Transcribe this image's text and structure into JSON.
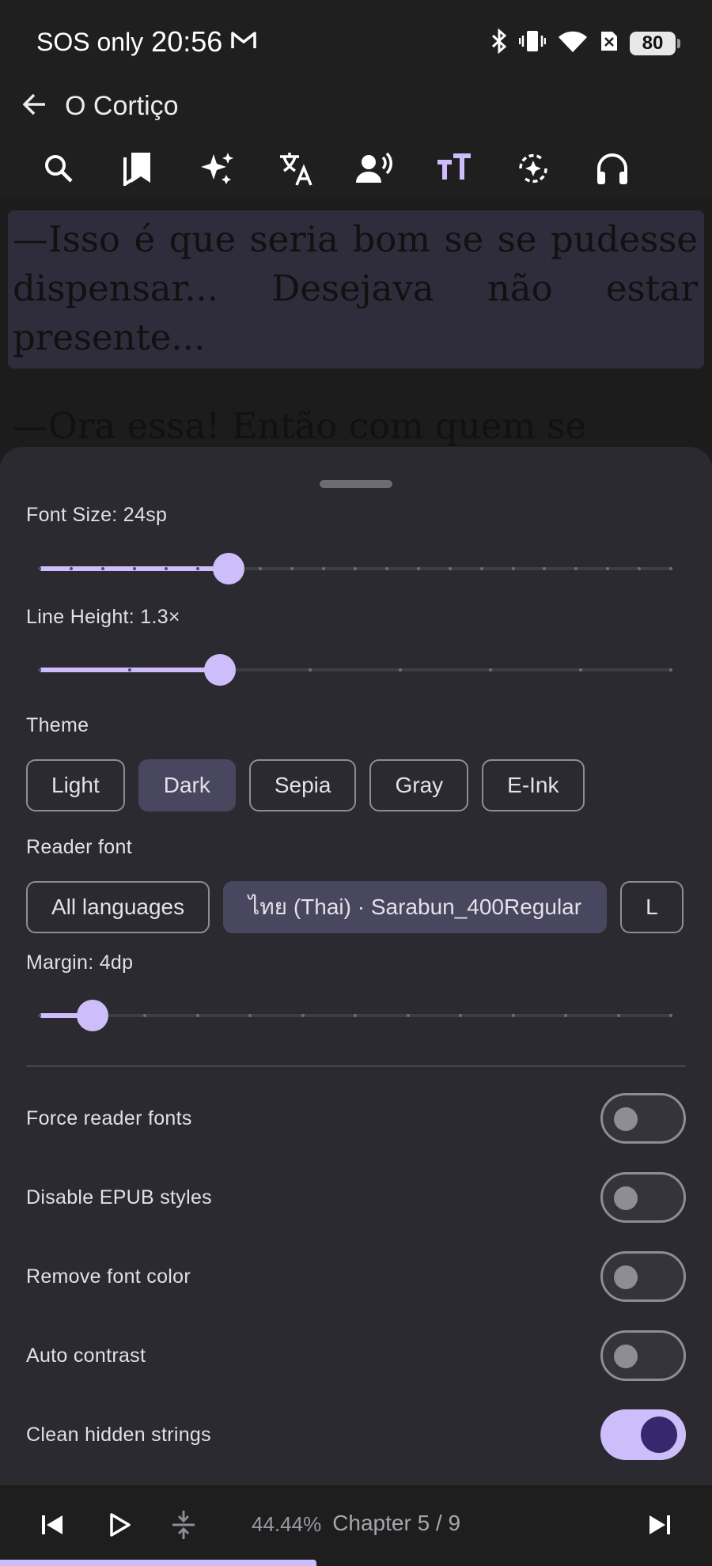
{
  "status_bar": {
    "carrier": "SOS only",
    "time": "20:56",
    "battery": "80"
  },
  "app_bar": {
    "title": "O Cortiço",
    "tools": [
      "search-icon",
      "bookmarks-icon",
      "ai-sparkle-icon",
      "translate-icon",
      "voice-icon",
      "text-format-icon",
      "auto-scroll-icon",
      "headphones-icon"
    ],
    "active_tool": "text-format-icon"
  },
  "reader": {
    "paragraph_1": "—Isso é que seria bom se se pudesse dispensar... Desejava não estar presente...",
    "paragraph_2": "—Ora essa! Então com quem se"
  },
  "settings": {
    "font_size": {
      "label": "Font Size: 24sp",
      "steps": 20,
      "value_step": 6
    },
    "line_height": {
      "label": "Line Height: 1.3×",
      "steps": 7,
      "value_step": 2
    },
    "theme": {
      "label": "Theme",
      "options": [
        "Light",
        "Dark",
        "Sepia",
        "Gray",
        "E-Ink"
      ],
      "selected": "Dark"
    },
    "reader_font": {
      "label": "Reader font",
      "options": [
        "All languages",
        "ไทย (Thai) · Sarabun_400Regular",
        "L"
      ],
      "selected": "ไทย (Thai) · Sarabun_400Regular"
    },
    "margin": {
      "label": "Margin: 4dp",
      "steps": 12,
      "value_step": 1
    },
    "toggles": [
      {
        "label": "Force reader fonts",
        "on": false
      },
      {
        "label": "Disable EPUB styles",
        "on": false
      },
      {
        "label": "Remove font color",
        "on": false
      },
      {
        "label": "Auto contrast",
        "on": false
      },
      {
        "label": "Clean hidden strings",
        "on": true
      }
    ]
  },
  "bottom_bar": {
    "progress_percent": "44.44%",
    "chapter": "Chapter 5 / 9",
    "progress_fraction": 0.4444
  },
  "colors": {
    "accent": "#cdbdfa",
    "sheet_background": "#2b2a30",
    "selected_chip": "#494660"
  }
}
